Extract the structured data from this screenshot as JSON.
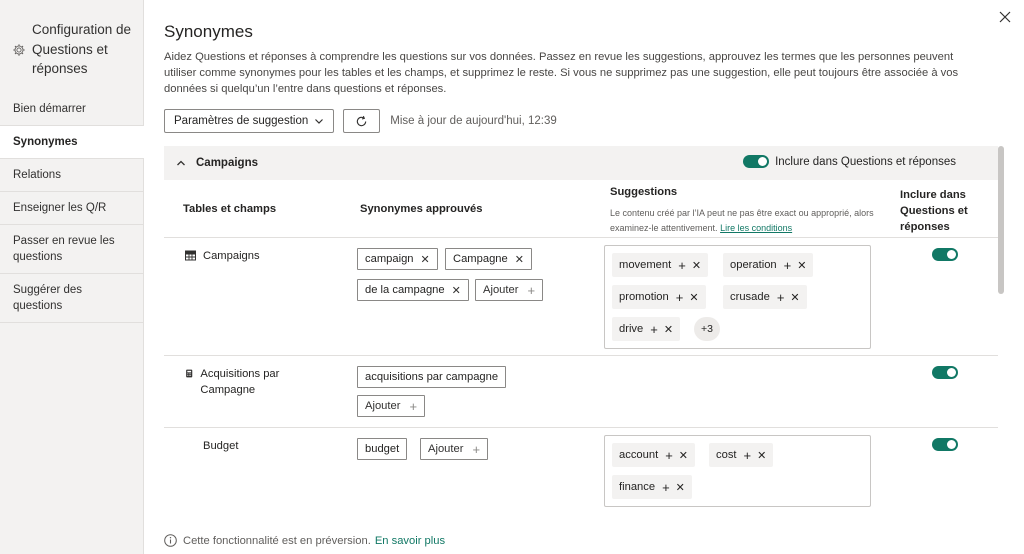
{
  "sidebar": {
    "title": "Configuration de Questions et réponses",
    "items": [
      {
        "label": "Bien démarrer"
      },
      {
        "label": "Synonymes"
      },
      {
        "label": "Relations"
      },
      {
        "label": "Enseigner les Q/R"
      },
      {
        "label": "Passer en revue les questions"
      },
      {
        "label": "Suggérer des questions"
      }
    ]
  },
  "main": {
    "title": "Synonymes",
    "description": "Aidez Questions et réponses à comprendre les questions sur vos données. Passez en revue les suggestions, approuvez les termes que les personnes peuvent utiliser comme synonymes pour les tables et les champs, et supprimez le reste. Si vous ne supprimez pas une suggestion, elle peut toujours être associée à vos données si quelqu’un l’entre dans questions et réponses.",
    "params_button": "Paramètres de suggestion",
    "updated": "Mise à jour de aujourd'hui, 12:39"
  },
  "panel": {
    "name": "Campaigns",
    "include_label": "Inclure dans Questions et réponses",
    "include_on": true,
    "col_tables": "Tables et champs",
    "col_approved": "Synonymes approuvés",
    "col_suggestions": "Suggestions",
    "col_suggestions_note": "Le contenu créé par l’IA peut ne pas être exact ou approprié, alors examinez-le attentivement.",
    "col_suggestions_link": "Lire les conditions",
    "col_include": "Inclure dans Questions et réponses"
  },
  "rows": [
    {
      "name": "Campaigns",
      "icon": "table-icon",
      "approved": [
        "campaign",
        "Campagne",
        "de la campagne"
      ],
      "add_label": "Ajouter",
      "suggestions": [
        "movement",
        "operation",
        "promotion",
        "crusade",
        "drive"
      ],
      "more": "+3",
      "included": true
    },
    {
      "name": "Acquisitions par Campagne",
      "icon": "calculator-icon",
      "approved": [
        "acquisitions par campagne"
      ],
      "add_label": "Ajouter",
      "suggestions": [],
      "included": true
    },
    {
      "name": "Budget",
      "icon": "",
      "approved": [
        "budget"
      ],
      "add_label": "Ajouter",
      "suggestions": [
        "account",
        "cost",
        "finance"
      ],
      "included": true
    }
  ],
  "footer": {
    "text": "Cette fonctionnalité est en préversion.",
    "link": "En savoir plus"
  },
  "colors": {
    "accent": "#117865",
    "sidebar_bg": "#f3f2f1"
  }
}
